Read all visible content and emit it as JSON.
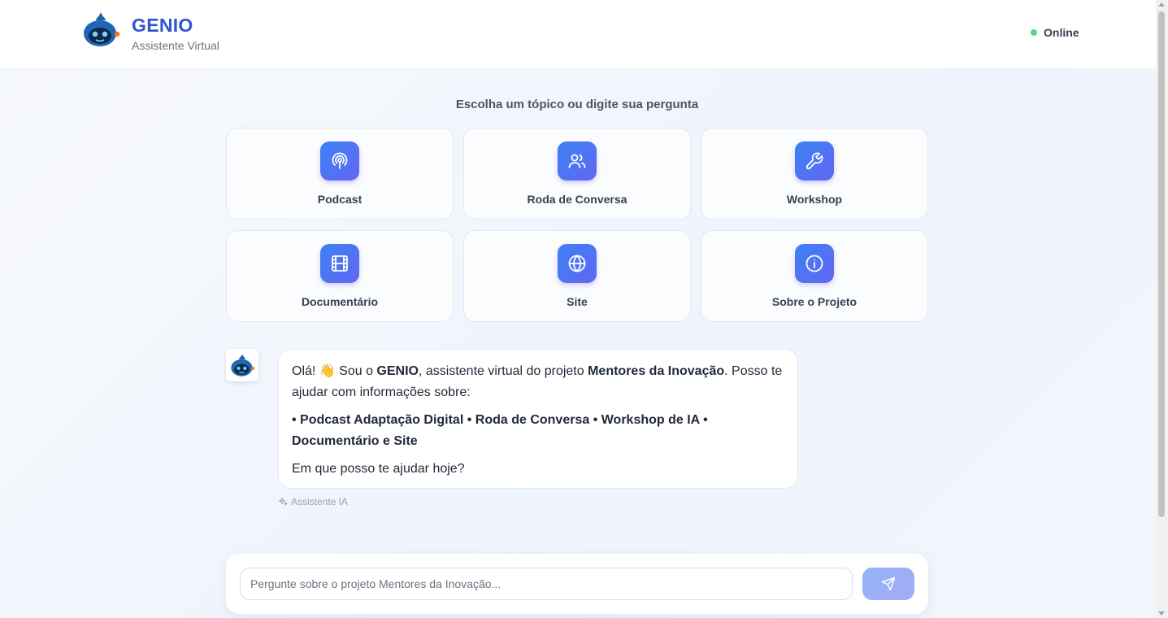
{
  "header": {
    "title": "GENIO",
    "subtitle": "Assistente Virtual",
    "status": "Online",
    "status_color": "#4ade80",
    "logo_icon": "robot-mascot-icon"
  },
  "topics": {
    "heading": "Escolha um tópico ou digite sua pergunta",
    "items": [
      {
        "label": "Podcast",
        "icon": "podcast-icon"
      },
      {
        "label": "Roda de Conversa",
        "icon": "users-icon"
      },
      {
        "label": "Workshop",
        "icon": "wrench-icon"
      },
      {
        "label": "Documentário",
        "icon": "film-icon"
      },
      {
        "label": "Site",
        "icon": "globe-icon"
      },
      {
        "label": "Sobre o Projeto",
        "icon": "info-icon"
      }
    ]
  },
  "message": {
    "greeting_1": "Olá! ",
    "wave_emoji": "👋",
    "greeting_2": " Sou o ",
    "bot_name": "GENIO",
    "greeting_3": ", assistente virtual do projeto ",
    "project_name": "Mentores da Inovação",
    "greeting_4": ". Posso te ajudar com informações sobre:",
    "topics_list": "• Podcast Adaptação Digital • Roda de Conversa • Workshop de IA • Documentário e Site",
    "closing": "Em que posso te ajudar hoje?",
    "meta_label": "Assistente IA"
  },
  "composer": {
    "placeholder": "Pergunte sobre o projeto Mentores da Inovação...",
    "value": ""
  },
  "colors": {
    "brand": "#2f55d4",
    "accent_gradient_start": "#3b82f6",
    "accent_gradient_end": "#6366f1"
  }
}
